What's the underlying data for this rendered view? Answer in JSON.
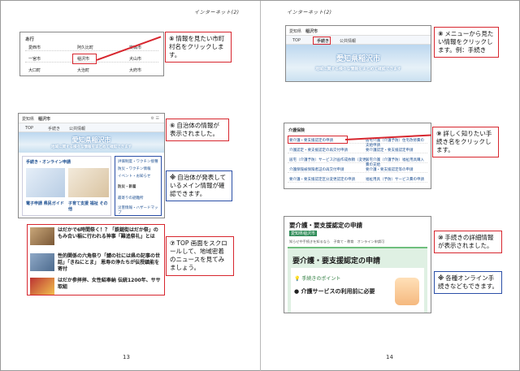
{
  "running_head": {
    "left": "インターネット(2)",
    "right": "インターネット(2)"
  },
  "page_numbers": {
    "left": "13",
    "right": "14"
  },
  "muni_list": {
    "header": "あ行",
    "rows": [
      [
        "愛西市",
        "阿久比町",
        "安城市"
      ],
      [
        "一宮市",
        "稲沢市",
        "犬山市"
      ],
      [
        "大口町",
        "大治町",
        "大府市"
      ]
    ]
  },
  "site": {
    "crumb": "愛知県",
    "city": "稲沢市",
    "nav": [
      "TOP",
      "手続き",
      "公共情報"
    ],
    "hero_title": "愛知県稲沢市",
    "hero_sub": "地域に関する様々な情報をまとめて確認できます",
    "left_card_title": "手続き・オンライン申請",
    "right_card_items": [
      "評価制度・ワクチン接種",
      "防災・ワクチン情報",
      "イベント・お知らせ"
    ],
    "right_card_head": "防災・新着",
    "thumbs": [
      "電子申請 県民ガイド",
      "子育て支援 福祉 その他"
    ],
    "right_card_foot": "最寄りの避難所",
    "right_card_foot2": "災害情報・ハザードマップ"
  },
  "news": [
    {
      "title": "はだかで6時間祭く！？「鉄鎚街はだか祭」のもみ合い稲に行われる神事「難追祭礼」とは",
      "source": "中日テレビ 11時間"
    },
    {
      "title": "性的関係の六角祭り「鯖の社には県の記事の世話」「きねにとま」 恩寿の浄たちが伝授鎮能を寄付",
      "source": "メーテレ（名古屋テレビ） 11時間"
    },
    {
      "title": "はだか参拝拝、女性紹奉納 伝統1200年、ササ取組",
      "source": ""
    }
  ],
  "callouts": {
    "c5": {
      "num": "⑤",
      "text": "情報を見たい市町村名をクリックします。"
    },
    "c6": {
      "num": "⑥",
      "text": "自治体の情報が表示されました。"
    },
    "note1": {
      "num": "※",
      "text": "自治体が発表しているメイン情報が確認できます。"
    },
    "c7": {
      "num": "⑦",
      "text": "TOP 画面をスクロールして、地域密着のニュースを見てみましょう。"
    },
    "c8": {
      "num": "⑧",
      "text": "メニューから見たい情報をクリックします。例：手続き"
    },
    "c9": {
      "num": "⑨",
      "text": "詳しく知りたい手続き名をクリックします。"
    },
    "c10": {
      "num": "⑩",
      "text": "手続きの詳細情報が表示されました。"
    },
    "note2": {
      "num": "※",
      "text": "各種オンライン手続きなどもできます。"
    }
  },
  "procedures": {
    "section": "介護保険",
    "rows": [
      [
        "要介護・要支援認定の申請",
        "居宅介護（介護予防）住宅改修費の支給申請"
      ],
      [
        "介護認定・要支援認定の再交付申請",
        "要介護認定・要支援認定申請"
      ],
      [
        "居宅（介護予防）サービス計画作成依頼（変更）",
        "居宅介護（介護予防）福祉用具購入費の支給"
      ],
      [
        "介護保険被保険者証の再交付申請",
        "要介護・要支援認定等の申請"
      ],
      [
        "要介護・要支援認定区分変更認定の申請",
        "福祉用具（予防）サービス費の申請"
      ]
    ]
  },
  "detail": {
    "page_title": "要介護・要支援認定の申請",
    "crumb_city": "愛知県稲沢市",
    "tags": "知らせ中手続きを知るなら　子育て・教育　オンライン申請可",
    "card_title": "要介護・要支援認定の申請",
    "point_label": "手続きのポイント",
    "point_item": "介護サービスの利用前に必要"
  }
}
